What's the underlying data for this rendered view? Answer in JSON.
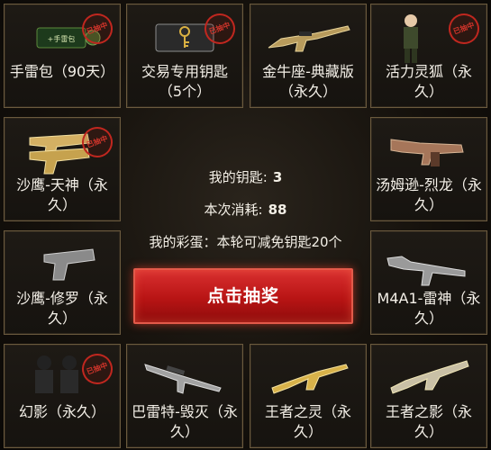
{
  "items": [
    {
      "label": "手雷包（90天）",
      "stamp": "已抽中",
      "icon": "grenade-pack-icon"
    },
    {
      "label": "交易专用钥匙（5个）",
      "stamp": "已抽中",
      "icon": "key-icon"
    },
    {
      "label": "金牛座-典藏版（永久）",
      "icon": "rifle-icon"
    },
    {
      "label": "活力灵狐（永久）",
      "stamp": "已抽中",
      "icon": "character-icon"
    },
    {
      "label": "沙鹰-天神（永久）",
      "stamp": "已抽中",
      "icon": "pistol-icon"
    },
    {
      "label": "汤姆逊-烈龙（永久）",
      "icon": "smg-icon"
    },
    {
      "label": "沙鹰-修罗（永久）",
      "icon": "pistol-icon"
    },
    {
      "label": "M4A1-雷神（永久）",
      "icon": "rifle-icon"
    },
    {
      "label": "幻影（永久）",
      "stamp": "已抽中",
      "icon": "character-icon"
    },
    {
      "label": "巴雷特-毁灭（永久）",
      "icon": "sniper-icon"
    },
    {
      "label": "王者之灵（永久）",
      "icon": "rifle-icon"
    },
    {
      "label": "王者之影（永久）",
      "icon": "rifle-icon"
    }
  ],
  "center": {
    "keys_label": "我的钥匙:",
    "keys_value": "3",
    "cost_label": "本次消耗:",
    "cost_value": "88",
    "egg_text": "我的彩蛋：本轮可减免钥匙20个",
    "draw_button": "点击抽奖"
  },
  "colors": {
    "border": "#6b5a3e",
    "button": "#c41a1a",
    "stamp": "#c0271f"
  }
}
